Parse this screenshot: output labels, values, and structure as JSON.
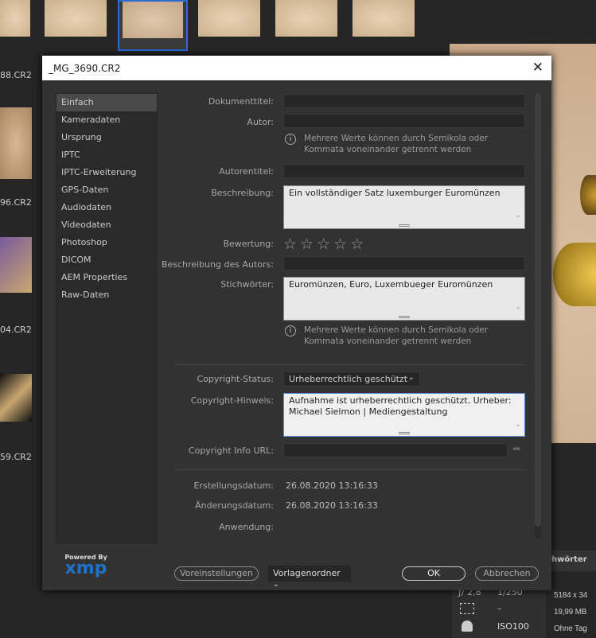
{
  "filmstrip": {
    "files": [
      "88.CR2",
      "96.CR2",
      "04.CR2",
      "59.CR2"
    ]
  },
  "dialog": {
    "title": "_MG_3690.CR2",
    "nav": [
      "Einfach",
      "Kameradaten",
      "Ursprung",
      "IPTC",
      "IPTC-Erweiterung",
      "GPS-Daten",
      "Audiodaten",
      "Videodaten",
      "Photoshop",
      "DICOM",
      "AEM Properties",
      "Raw-Daten"
    ],
    "fields": {
      "dokumenttitel": {
        "label": "Dokumenttitel:",
        "value": ""
      },
      "autor": {
        "label": "Autor:",
        "value": ""
      },
      "autor_hint": "Mehrere Werte können durch Semikola oder Kommata voneinander getrennt werden",
      "autorentitel": {
        "label": "Autorentitel:",
        "value": ""
      },
      "beschreibung": {
        "label": "Beschreibung:",
        "value": "Ein vollständiger Satz luxemburger Euromünzen"
      },
      "bewertung": {
        "label": "Bewertung:",
        "stars": 0,
        "max": 5
      },
      "beschreibung_autor": {
        "label": "Beschreibung des Autors:",
        "value": ""
      },
      "stichwoerter": {
        "label": "Stichwörter:",
        "value": "Euromünzen, Euro, Luxembueger Euromünzen"
      },
      "stichwoerter_hint": "Mehrere Werte können durch Semikola oder Kommata voneinander getrennt werden",
      "copyright_status": {
        "label": "Copyright-Status:",
        "value": "Urheberrechtlich geschützt"
      },
      "copyright_hinweis": {
        "label": "Copyright-Hinweis:",
        "value": "Aufnahme ist urheberrechtlich geschützt. Urheber: Michael Sielmon | Mediengestaltung"
      },
      "copyright_url": {
        "label": "Copyright Info URL:",
        "value": ""
      },
      "erstellungsdatum": {
        "label": "Erstellungsdatum:",
        "value": "26.08.2020 13:16:33"
      },
      "aenderungsdatum": {
        "label": "Änderungsdatum:",
        "value": "26.08.2020 13:16:33"
      },
      "anwendung": {
        "label": "Anwendung:",
        "value": ""
      }
    },
    "logo": {
      "powered": "Powered By",
      "brand": "xmp"
    },
    "buttons": {
      "presets": "Voreinstellungen",
      "template": "Vorlagenordner",
      "ok": "OK",
      "cancel": "Abbrechen"
    }
  },
  "info_panel": {
    "tab": "hwörter",
    "aperture": "ƒ/ 2,8",
    "shutter": "1/250",
    "metering": "–",
    "iso": "ISO100",
    "dimensions": "5184 x 34",
    "size": "19,99 MB",
    "tags": "Ohne Tag"
  }
}
